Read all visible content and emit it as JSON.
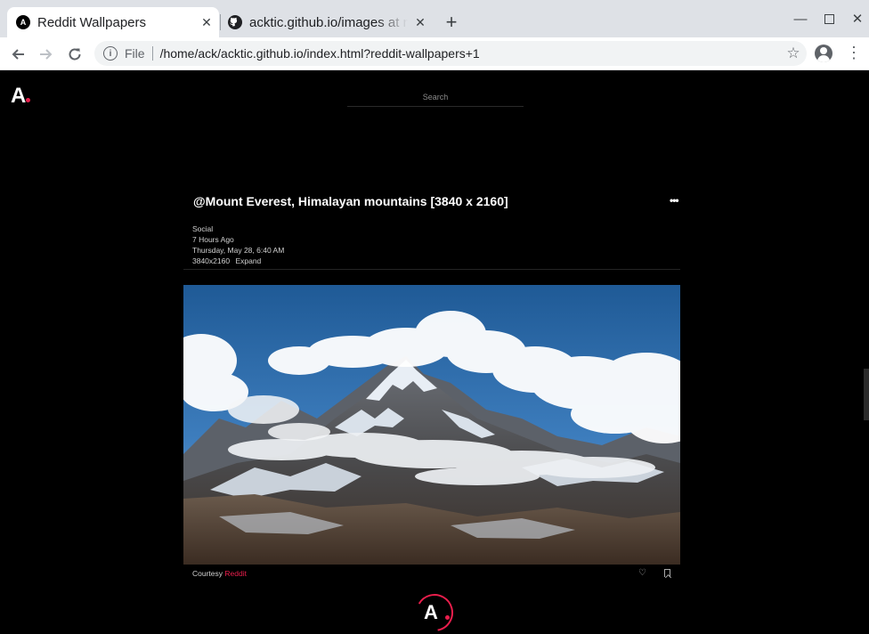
{
  "browser": {
    "tabs": [
      {
        "title": "Reddit Wallpapers",
        "favicon": "A",
        "active": true
      },
      {
        "title": "acktic.github.io/images at master",
        "favicon": "github-icon",
        "active": false
      }
    ],
    "address": {
      "scheme": "File",
      "url": "/home/ack/acktic.github.io/index.html?reddit-wallpapers+1"
    }
  },
  "site": {
    "logo": "A",
    "search_placeholder": "Search"
  },
  "post": {
    "title": "@Mount Everest, Himalayan mountains [3840 x 2160]",
    "more_label": "•••",
    "source_type": "Social",
    "relative_time": "7 Hours Ago",
    "datetime": "Thursday, May 28, 6:40 AM",
    "resolution": "3840x2160",
    "expand_label": "Expand",
    "courtesy_label": "Courtesy",
    "courtesy_source": "Reddit"
  },
  "loader": {
    "letter": "A"
  },
  "colors": {
    "accent": "#e91e4c",
    "background": "#000000"
  }
}
